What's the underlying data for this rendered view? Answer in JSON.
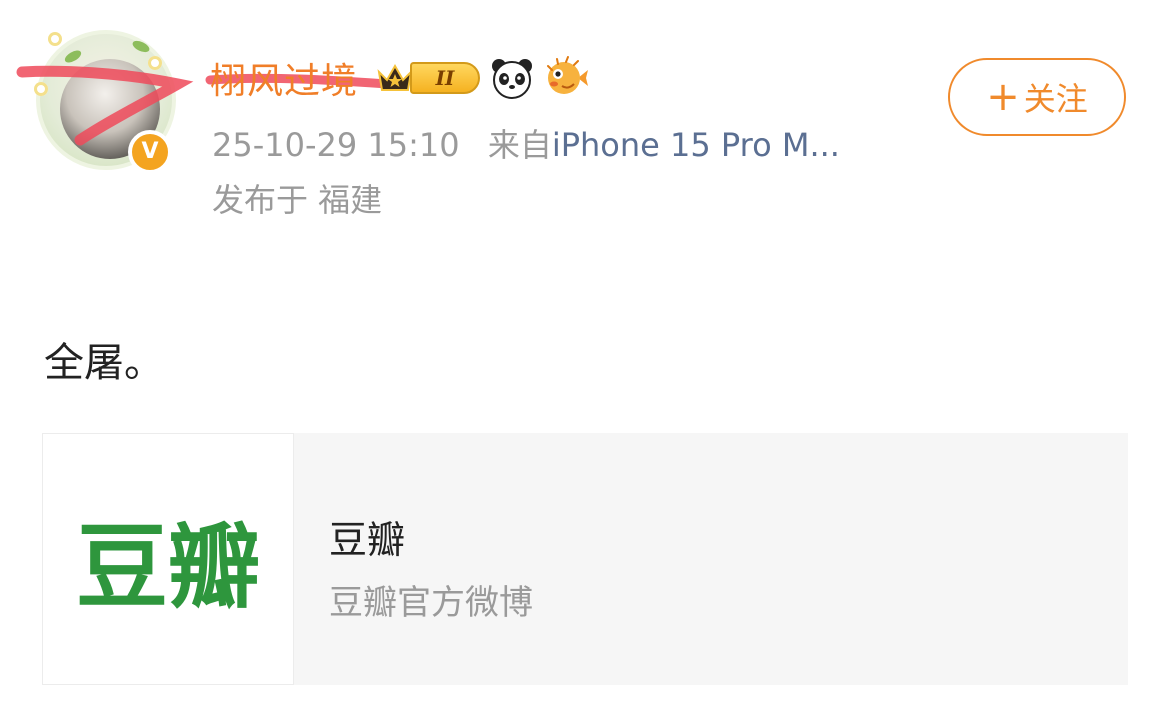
{
  "user": {
    "name": "栩风过境",
    "level": "II",
    "verified_mark": "V"
  },
  "meta": {
    "timestamp": "25-10-29 15:10",
    "from_label": "来自",
    "source": "iPhone 15 Pro M...",
    "location": "发布于 福建"
  },
  "follow": {
    "plus": "+",
    "label": "关注"
  },
  "post": {
    "text": "全屠。"
  },
  "card": {
    "logo_text": "豆瓣",
    "title": "豆瓣",
    "subtitle": "豆瓣官方微博"
  },
  "icons": {
    "crown": "crown-icon",
    "panda": "panda-emoji-icon",
    "pufferfish": "pufferfish-emoji-icon"
  },
  "colors": {
    "username": "#f07e28",
    "accent": "#f08a2c",
    "source_link": "#5b6f92",
    "douban_green": "#2e963d",
    "verified": "#f4a420",
    "scribble": "#ee4a5a"
  }
}
